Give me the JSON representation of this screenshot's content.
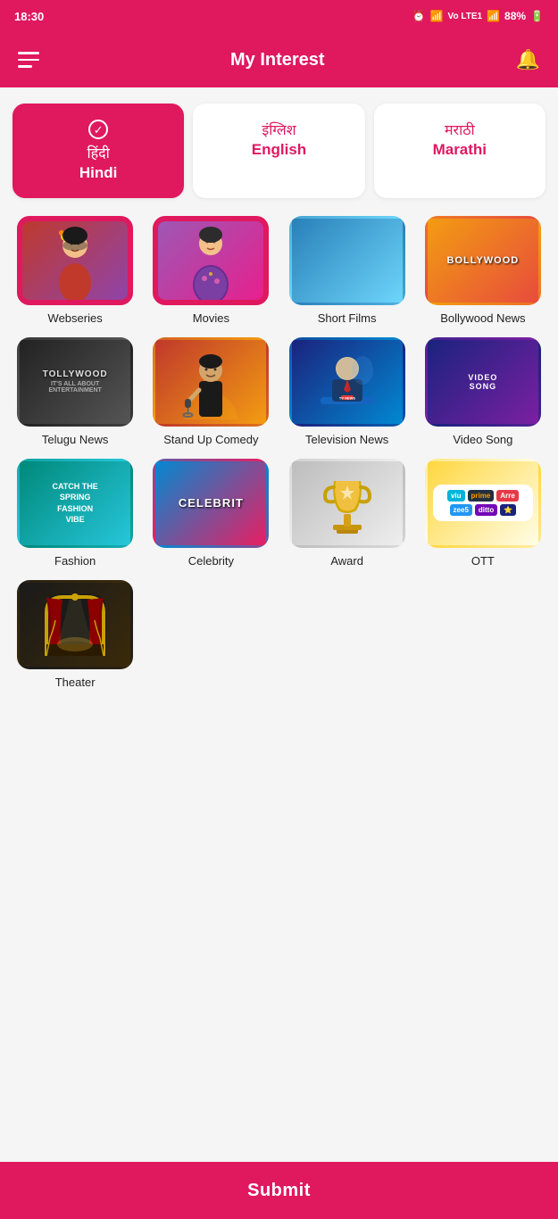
{
  "statusBar": {
    "time": "18:30",
    "battery": "88%",
    "icons": "alarm wifi lte signal"
  },
  "header": {
    "title": "My Interest",
    "menuIcon": "≡",
    "bellIcon": "🔔"
  },
  "languages": [
    {
      "id": "hindi",
      "native": "हिंदी",
      "english": "Hindi",
      "active": true
    },
    {
      "id": "english",
      "native": "इंग्लिश",
      "english": "English",
      "active": false
    },
    {
      "id": "marathi",
      "native": "मराठी",
      "english": "Marathi",
      "active": false
    }
  ],
  "interests": [
    {
      "id": "webseries",
      "label": "Webseries",
      "selected": true,
      "bg": "bg-webseries"
    },
    {
      "id": "movies",
      "label": "Movies",
      "selected": true,
      "bg": "bg-movies"
    },
    {
      "id": "shortfilms",
      "label": "Short Films",
      "selected": false,
      "bg": "bg-shortfilms"
    },
    {
      "id": "bollywood",
      "label": "Bollywood News",
      "selected": false,
      "bg": "bg-bollywood"
    },
    {
      "id": "telugu",
      "label": "Telugu News",
      "selected": false,
      "bg": "bg-telugu"
    },
    {
      "id": "standup",
      "label": "Stand Up Comedy",
      "selected": false,
      "bg": "bg-standup"
    },
    {
      "id": "tvnews",
      "label": "Television News",
      "selected": false,
      "bg": "bg-tvnews"
    },
    {
      "id": "videosong",
      "label": "Video Song",
      "selected": false,
      "bg": "bg-videosong"
    },
    {
      "id": "fashion",
      "label": "Fashion",
      "selected": false,
      "bg": "bg-fashion"
    },
    {
      "id": "celebrity",
      "label": "Celebrity",
      "selected": false,
      "bg": "bg-celebrity"
    },
    {
      "id": "award",
      "label": "Award",
      "selected": false,
      "bg": "bg-award"
    },
    {
      "id": "ott",
      "label": "OTT",
      "selected": false,
      "bg": "bg-ott"
    },
    {
      "id": "theater",
      "label": "Theater",
      "selected": false,
      "bg": "bg-theater"
    }
  ],
  "submit": {
    "label": "Submit"
  }
}
